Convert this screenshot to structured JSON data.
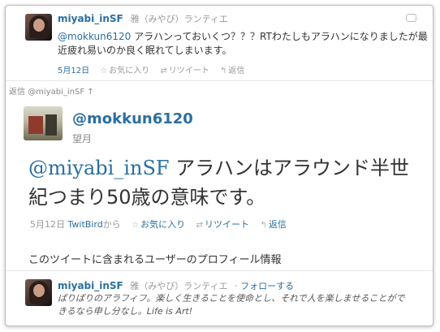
{
  "in_reply_to_tweet": {
    "screen_name": "miyabi_inSF",
    "full_name": "雅（みやび）ランティエ",
    "mention": "@mokkun6120",
    "text": " アラハンっておいくつ？？？RTわたしもアラハンになりましたが最近疲れ易いのか良く眠れてしまいます。",
    "date": "5月12日",
    "favorite_label": "お気に入り",
    "retweet_label": "リツイート",
    "reply_label": "返信",
    "favorite_icon": "star-icon",
    "retweet_icon": "retweet-icon",
    "reply_icon": "reply-icon"
  },
  "reply_divider": {
    "label": "返信 @miyabi_inSF ↑"
  },
  "main_tweet": {
    "screen_name": "@mokkun6120",
    "full_name": "望月",
    "mention": "@miyabi_inSF",
    "text": " アラハンはアラウンド半世紀つまり50歳の意味です。",
    "date": "5月12日",
    "via": "TwitBird",
    "via_suffix": "から",
    "favorite_label": "お気に入り",
    "retweet_label": "リツイート",
    "reply_label": "返信"
  },
  "profile_section": {
    "title": "このツイートに含まれるユーザーのプロフィール情報",
    "screen_name": "miyabi_inSF",
    "full_name": "雅（みやび）ランティエ",
    "separator": "·",
    "follow_label": "フォローする",
    "bio": "ぱりぱりのアラフィフ。楽しく生きることを使命とし、それで人を楽しませることができるなら申し分なし。Life is Art!"
  },
  "colors": {
    "link": "#2a6fa0",
    "muted": "#999999"
  }
}
